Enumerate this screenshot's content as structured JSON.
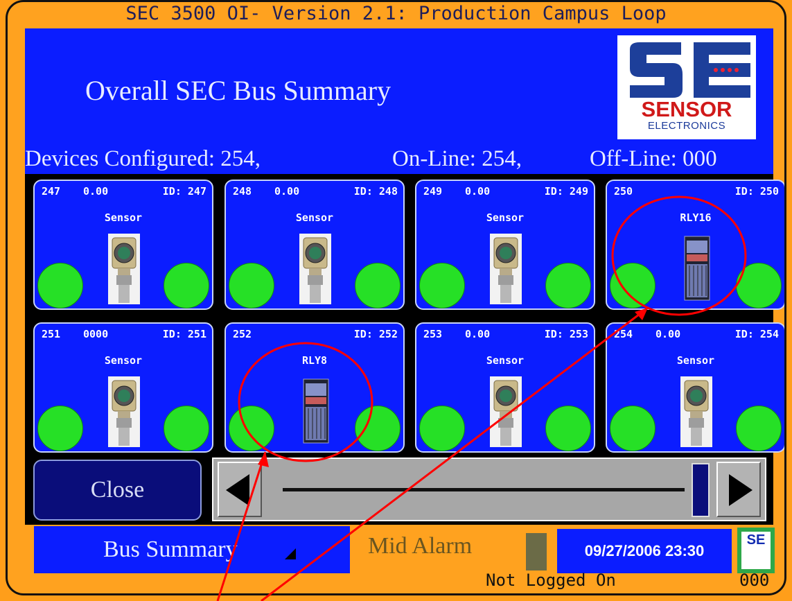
{
  "window": {
    "title": "SEC 3500 OI- Version 2.1: Production Campus Loop"
  },
  "header": {
    "page_title": "Overall SEC Bus Summary",
    "logo": {
      "big_text": "SE",
      "brand": "SENSOR",
      "subtitle": "ELECTRONICS"
    },
    "counts": {
      "configured": "Devices Configured: 254,",
      "online": "On-Line: 254,",
      "offline": "Off-Line: 000"
    }
  },
  "tiles": [
    {
      "addr": "247",
      "value": "0.00",
      "id": "ID: 247",
      "type": "Sensor",
      "icon": "gas-sensor-icon",
      "status_left": "green",
      "status_right": "green"
    },
    {
      "addr": "248",
      "value": "0.00",
      "id": "ID: 248",
      "type": "Sensor",
      "icon": "gas-sensor-icon",
      "status_left": "green",
      "status_right": "green"
    },
    {
      "addr": "249",
      "value": "0.00",
      "id": "ID: 249",
      "type": "Sensor",
      "icon": "gas-sensor-icon",
      "status_left": "green",
      "status_right": "green"
    },
    {
      "addr": "250",
      "value": "",
      "id": "ID: 250",
      "type": "RLY16",
      "icon": "relay-module-icon",
      "status_left": "green",
      "status_right": "green"
    },
    {
      "addr": "251",
      "value": "0000",
      "id": "ID: 251",
      "type": "Sensor",
      "icon": "gas-sensor-icon",
      "status_left": "green",
      "status_right": "green"
    },
    {
      "addr": "252",
      "value": "",
      "id": "ID: 252",
      "type": "RLY8",
      "icon": "relay-module-icon",
      "status_left": "green",
      "status_right": "green"
    },
    {
      "addr": "253",
      "value": "0.00",
      "id": "ID: 253",
      "type": "Sensor",
      "icon": "gas-sensor-icon",
      "status_left": "green",
      "status_right": "green"
    },
    {
      "addr": "254",
      "value": "0.00",
      "id": "ID: 254",
      "type": "Sensor",
      "icon": "gas-sensor-icon",
      "status_left": "green",
      "status_right": "green"
    }
  ],
  "controls": {
    "close_label": "Close",
    "scroll_left_icon": "triangle-left-icon",
    "scroll_right_icon": "triangle-right-icon"
  },
  "status_bar": {
    "screen_name": "Bus Summary",
    "alarm_label": "Mid Alarm",
    "datetime": "09/27/2006 23:30",
    "login_status": "Not Logged On",
    "user_code": "000"
  },
  "colors": {
    "frame": "#ffa21f",
    "panel_blue": "#0b1dff",
    "led_green": "#26e026",
    "annotation_red": "#ff0000"
  }
}
